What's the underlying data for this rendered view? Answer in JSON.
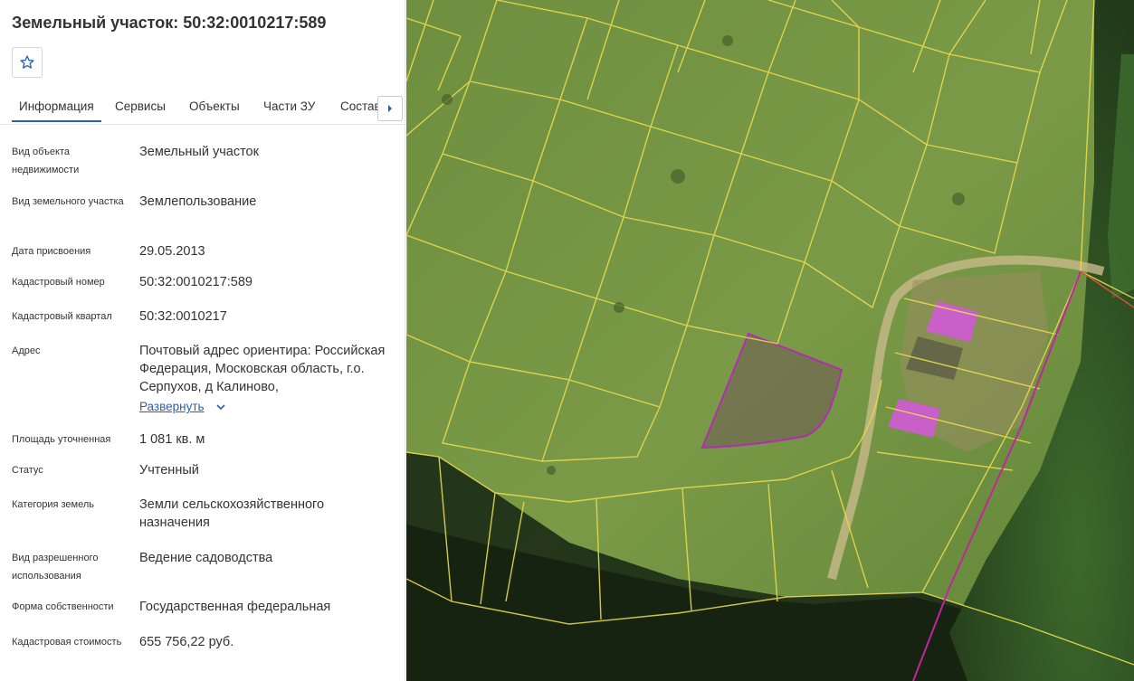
{
  "header": {
    "title": "Земельный участок: 50:32:0010217:589"
  },
  "tabs": [
    {
      "label": "Информация",
      "active": true
    },
    {
      "label": "Сервисы"
    },
    {
      "label": "Объекты"
    },
    {
      "label": "Части ЗУ"
    },
    {
      "label": "Состав"
    }
  ],
  "fields": [
    {
      "label": "Вид объекта недвижимости",
      "value": "Земельный участок"
    },
    {
      "label": "Вид земельного участка",
      "value": "Землепользование"
    },
    {
      "label": "Дата присвоения",
      "value": "29.05.2013"
    },
    {
      "label": "Кадастровый номер",
      "value": "50:32:0010217:589"
    },
    {
      "label": "Кадастровый квартал",
      "value": "50:32:0010217"
    },
    {
      "label": "Адрес",
      "value": "Почтовый адрес ориентира: Российская Федерация, Московская область, г.о. Серпухов, д Калиново,",
      "link": "Развернуть"
    },
    {
      "label": "Площадь уточненная",
      "value": "1 081 кв. м"
    },
    {
      "label": "Статус",
      "value": "Учтенный"
    },
    {
      "label": "Категория земель",
      "value": "Земли сельскохозяйственного назначения"
    },
    {
      "label": "Вид разрешенного использования",
      "value": "Ведение садоводства"
    },
    {
      "label": "Форма собственности",
      "value": "Государственная федеральная"
    },
    {
      "label": "Кадастровая стоимость",
      "value": "655 756,22 руб."
    }
  ],
  "colors": {
    "accent": "#2b5fb0",
    "parcel_boundary": "#e8d94f",
    "selected_parcel": "#b02fb0",
    "building": "#d05bd6"
  },
  "icons": {
    "favorite": "star-outline-icon",
    "tabs_next": "caret-right-icon",
    "expand": "chevron-down-icon"
  }
}
